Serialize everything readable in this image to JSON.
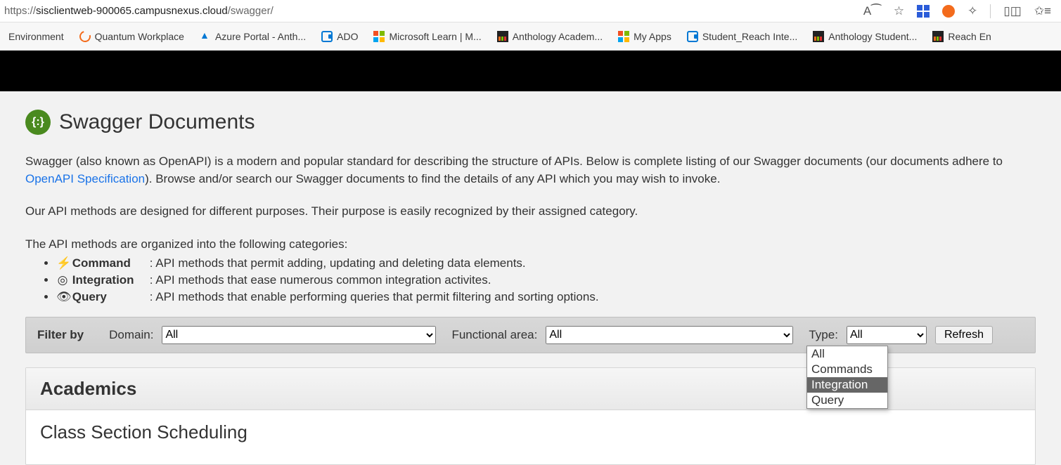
{
  "address_bar": {
    "url_prefix": "https://",
    "url_host": "sisclientweb-900065.campusnexus.cloud",
    "url_path": "/swagger/"
  },
  "bookmarks": [
    {
      "label": "Environment",
      "icon": "none"
    },
    {
      "label": "Quantum Workplace",
      "icon": "qw"
    },
    {
      "label": "Azure Portal - Anth...",
      "icon": "az"
    },
    {
      "label": "ADO",
      "icon": "ado"
    },
    {
      "label": "Microsoft Learn | M...",
      "icon": "ms"
    },
    {
      "label": "Anthology Academ...",
      "icon": "bars"
    },
    {
      "label": "My Apps",
      "icon": "ms"
    },
    {
      "label": "Student_Reach Inte...",
      "icon": "ado"
    },
    {
      "label": "Anthology Student...",
      "icon": "bars"
    },
    {
      "label": "Reach En",
      "icon": "bars"
    }
  ],
  "page_title": "Swagger Documents",
  "intro": {
    "p1a": "Swagger (also known as OpenAPI) is a modern and popular standard for describing the structure of APIs. Below is complete listing of our Swagger documents (our documents adhere to ",
    "link": "OpenAPI Specification",
    "p1b": "). Browse and/or search our Swagger documents to find the details of any API which you may wish to invoke.",
    "p2": "Our API methods are designed for different purposes. Their purpose is easily recognized by their assigned category.",
    "p3": "The API methods are organized into the following categories:"
  },
  "categories": [
    {
      "icon": "⚡",
      "name": "Command",
      "desc": ": API methods that permit adding, updating and deleting data elements."
    },
    {
      "icon": "◎",
      "name": "Integration",
      "desc": ": API methods that ease numerous common integration activites."
    },
    {
      "icon": "👁",
      "name": "Query",
      "desc": ": API methods that enable performing queries that permit filtering and sorting options."
    }
  ],
  "filter": {
    "heading": "Filter by",
    "domain_label": "Domain:",
    "domain_value": "All",
    "fa_label": "Functional area:",
    "fa_value": "All",
    "type_label": "Type:",
    "type_value": "All",
    "refresh": "Refresh",
    "type_options": [
      "All",
      "Commands",
      "Integration",
      "Query"
    ],
    "type_highlight": "Integration"
  },
  "section": {
    "header": "Academics",
    "item": "Class Section Scheduling"
  }
}
